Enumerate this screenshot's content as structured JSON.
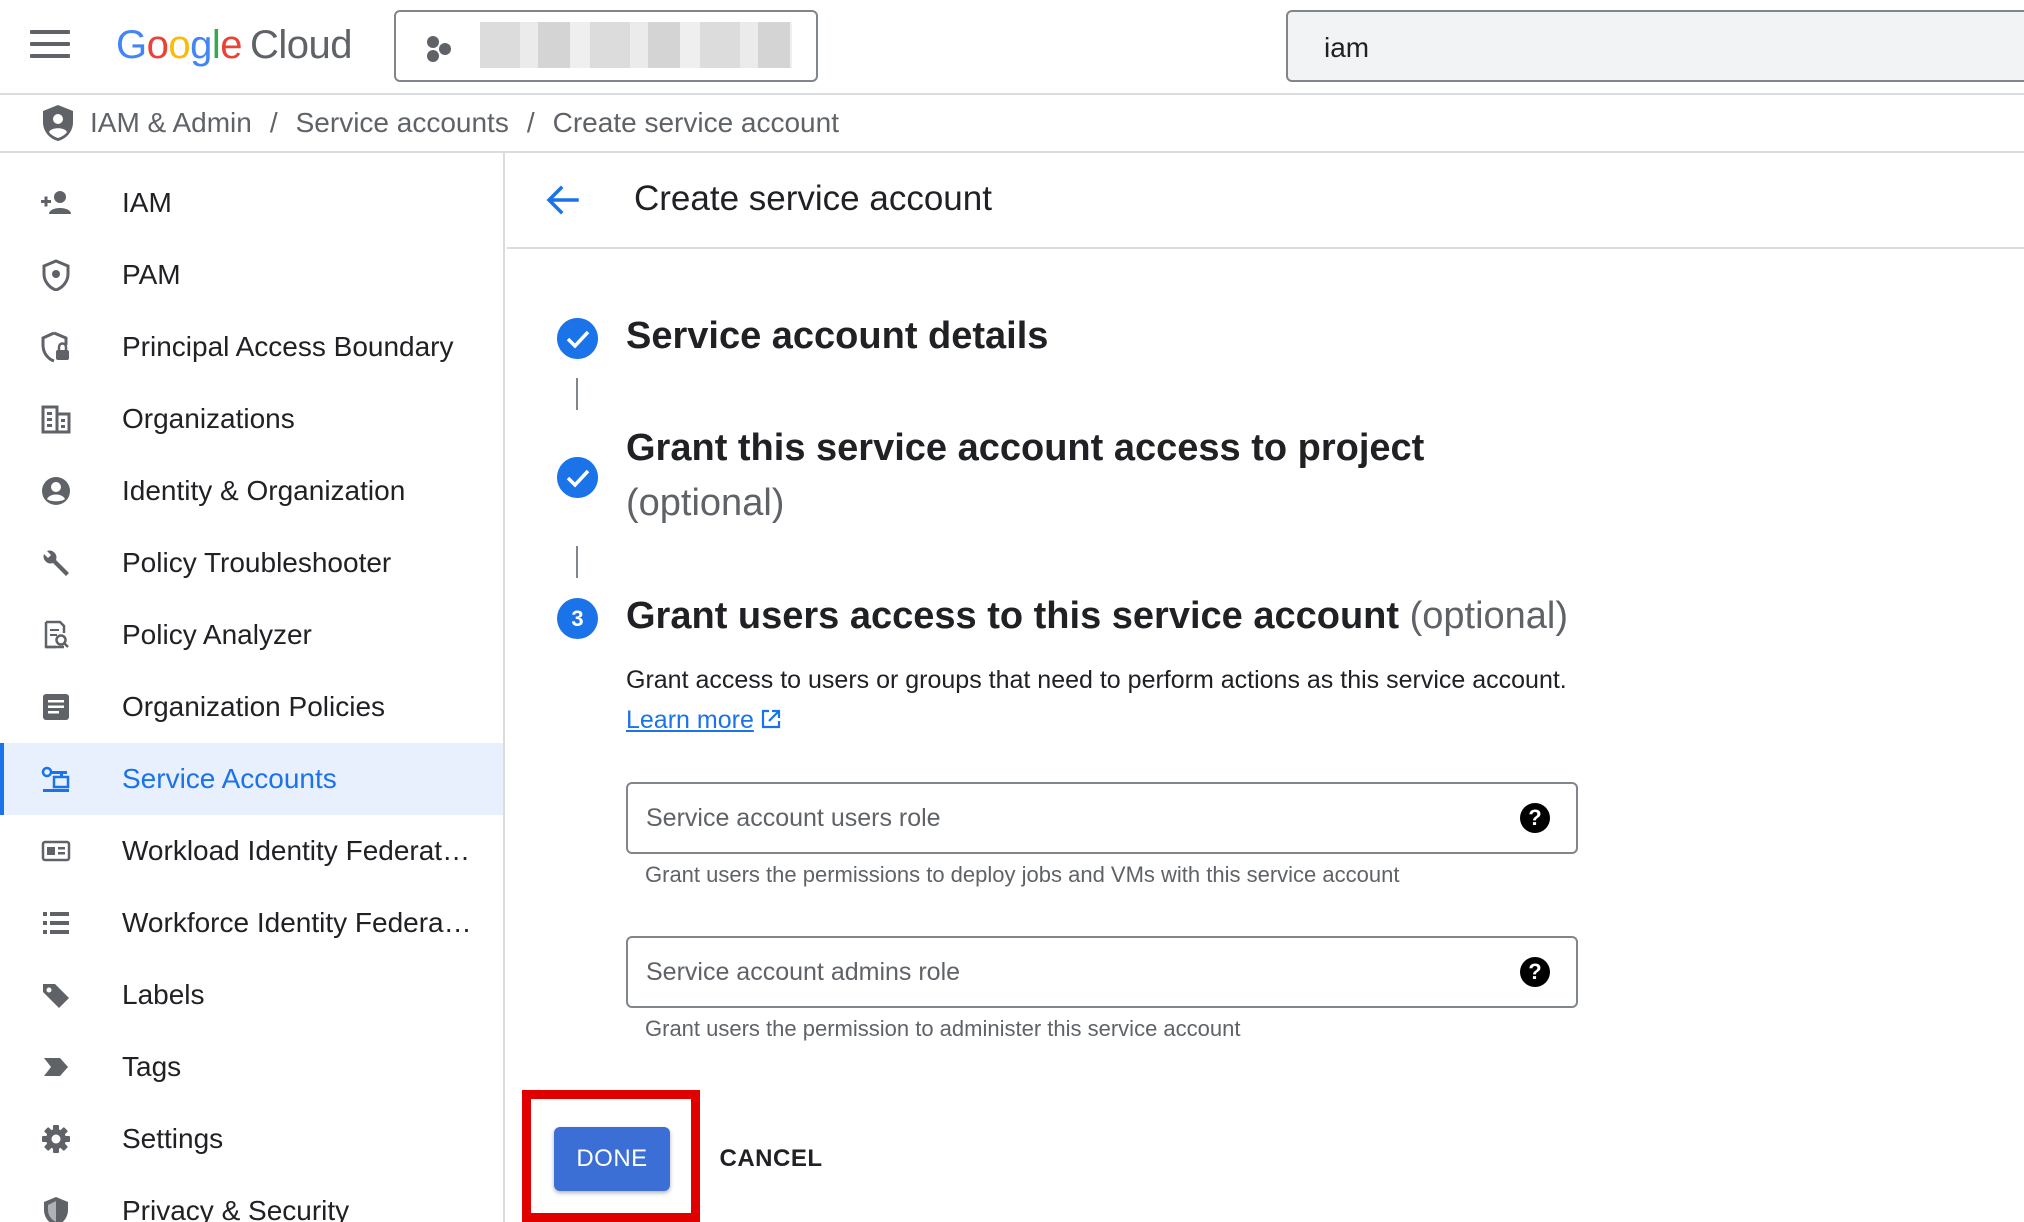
{
  "header": {
    "logo_google": "Google",
    "logo_cloud": "Cloud",
    "search_value": "iam"
  },
  "breadcrumb": {
    "items": [
      "IAM & Admin",
      "Service accounts",
      "Create service account"
    ],
    "separator": "/"
  },
  "sidebar": {
    "items": [
      {
        "label": "IAM",
        "icon": "person-add-icon"
      },
      {
        "label": "PAM",
        "icon": "shield-icon"
      },
      {
        "label": "Principal Access Boundary",
        "icon": "shield-lock-icon"
      },
      {
        "label": "Organizations",
        "icon": "building-icon"
      },
      {
        "label": "Identity & Organization",
        "icon": "account-circle-icon"
      },
      {
        "label": "Policy Troubleshooter",
        "icon": "wrench-icon"
      },
      {
        "label": "Policy Analyzer",
        "icon": "document-search-icon"
      },
      {
        "label": "Organization Policies",
        "icon": "list-document-icon"
      },
      {
        "label": "Service Accounts",
        "icon": "service-account-icon",
        "active": true
      },
      {
        "label": "Workload Identity Federat…",
        "icon": "id-card-icon"
      },
      {
        "label": "Workforce Identity Federa…",
        "icon": "list-icon"
      },
      {
        "label": "Labels",
        "icon": "label-icon"
      },
      {
        "label": "Tags",
        "icon": "tag-chevron-icon"
      },
      {
        "label": "Settings",
        "icon": "gear-icon"
      },
      {
        "label": "Privacy & Security",
        "icon": "shield-icon"
      }
    ]
  },
  "main": {
    "title": "Create service account",
    "steps": [
      {
        "title": "Service account details",
        "optional": "",
        "state": "complete"
      },
      {
        "title": "Grant this service account access to project",
        "optional": "(optional)",
        "state": "complete"
      },
      {
        "number": "3",
        "title": "Grant users access to this service account",
        "optional": "(optional)",
        "state": "active"
      }
    ],
    "description": "Grant access to users or groups that need to perform actions as this service account.",
    "learn_more": "Learn more",
    "fields": [
      {
        "placeholder": "Service account users role",
        "hint": "Grant users the permissions to deploy jobs and VMs with this service account"
      },
      {
        "placeholder": "Service account admins role",
        "hint": "Grant users the permission to administer this service account"
      }
    ],
    "help_glyph": "?",
    "done_label": "DONE",
    "cancel_label": "CANCEL"
  },
  "colors": {
    "accent": "#1a73e8",
    "active_bg": "#e8f0fe",
    "highlight": "#e00000",
    "done_button": "#3b6fd6"
  }
}
